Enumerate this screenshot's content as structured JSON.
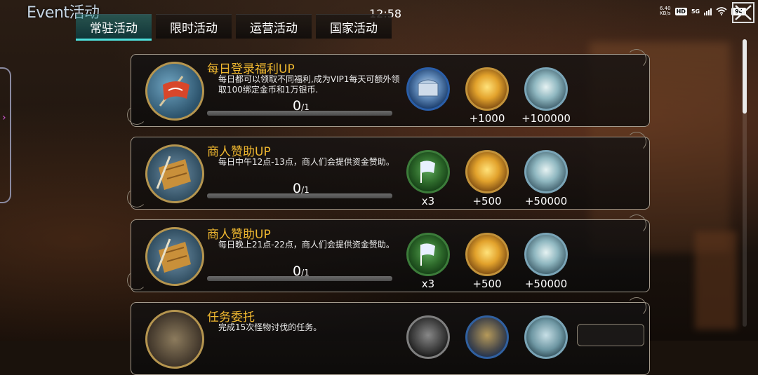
{
  "status_bar": {
    "time": "12:58",
    "net_speed_value": "6.40",
    "net_speed_unit": "KB/s",
    "hd": "HD",
    "network": "5G",
    "battery": "94"
  },
  "header": {
    "title": "Event活动",
    "close_icon": "close-x-icon"
  },
  "tabs": [
    {
      "label": "常驻活动",
      "active": true
    },
    {
      "label": "限时活动",
      "active": false
    },
    {
      "label": "运营活动",
      "active": false
    },
    {
      "label": "国家活动",
      "active": false
    }
  ],
  "events": [
    {
      "title": "每日登录福利UP",
      "description": "每日都可以领取不同福利,成为VIP1每天可额外领取100绑定金币和1万银币.",
      "progress_current": "0",
      "progress_total": "/1",
      "icon": "red-banner-icon",
      "rewards": [
        {
          "icon": "silver-chest-icon",
          "label": ""
        },
        {
          "icon": "gold-coins-icon",
          "label": "+1000"
        },
        {
          "icon": "silver-coins-icon",
          "label": "+100000"
        }
      ]
    },
    {
      "title": "商人赞助UP",
      "description": "每日中午12点-13点，商人们会提供资金赞助。",
      "progress_current": "0",
      "progress_total": "/1",
      "icon": "treasure-map-icon",
      "rewards": [
        {
          "icon": "green-flag-icon",
          "label": "x3"
        },
        {
          "icon": "gold-coins-icon",
          "label": "+500"
        },
        {
          "icon": "silver-coins-icon",
          "label": "+50000"
        }
      ]
    },
    {
      "title": "商人赞助UP",
      "description": "每日晚上21点-22点，商人们会提供资金赞助。",
      "progress_current": "0",
      "progress_total": "/1",
      "icon": "treasure-map-icon",
      "rewards": [
        {
          "icon": "green-flag-icon",
          "label": "x3"
        },
        {
          "icon": "gold-coins-icon",
          "label": "+500"
        },
        {
          "icon": "silver-coins-icon",
          "label": "+50000"
        }
      ]
    },
    {
      "title": "任务委托",
      "description": "完成15次怪物讨伐的任务。",
      "icon": "scroll-icon",
      "rewards": [
        {
          "icon": "dark-item-icon",
          "label": ""
        },
        {
          "icon": "blue-item-icon",
          "label": ""
        },
        {
          "icon": "silver-coins-icon",
          "label": ""
        }
      ]
    }
  ],
  "colors": {
    "title_gold": "#f0b830",
    "tab_active": "#4ee0dc"
  }
}
